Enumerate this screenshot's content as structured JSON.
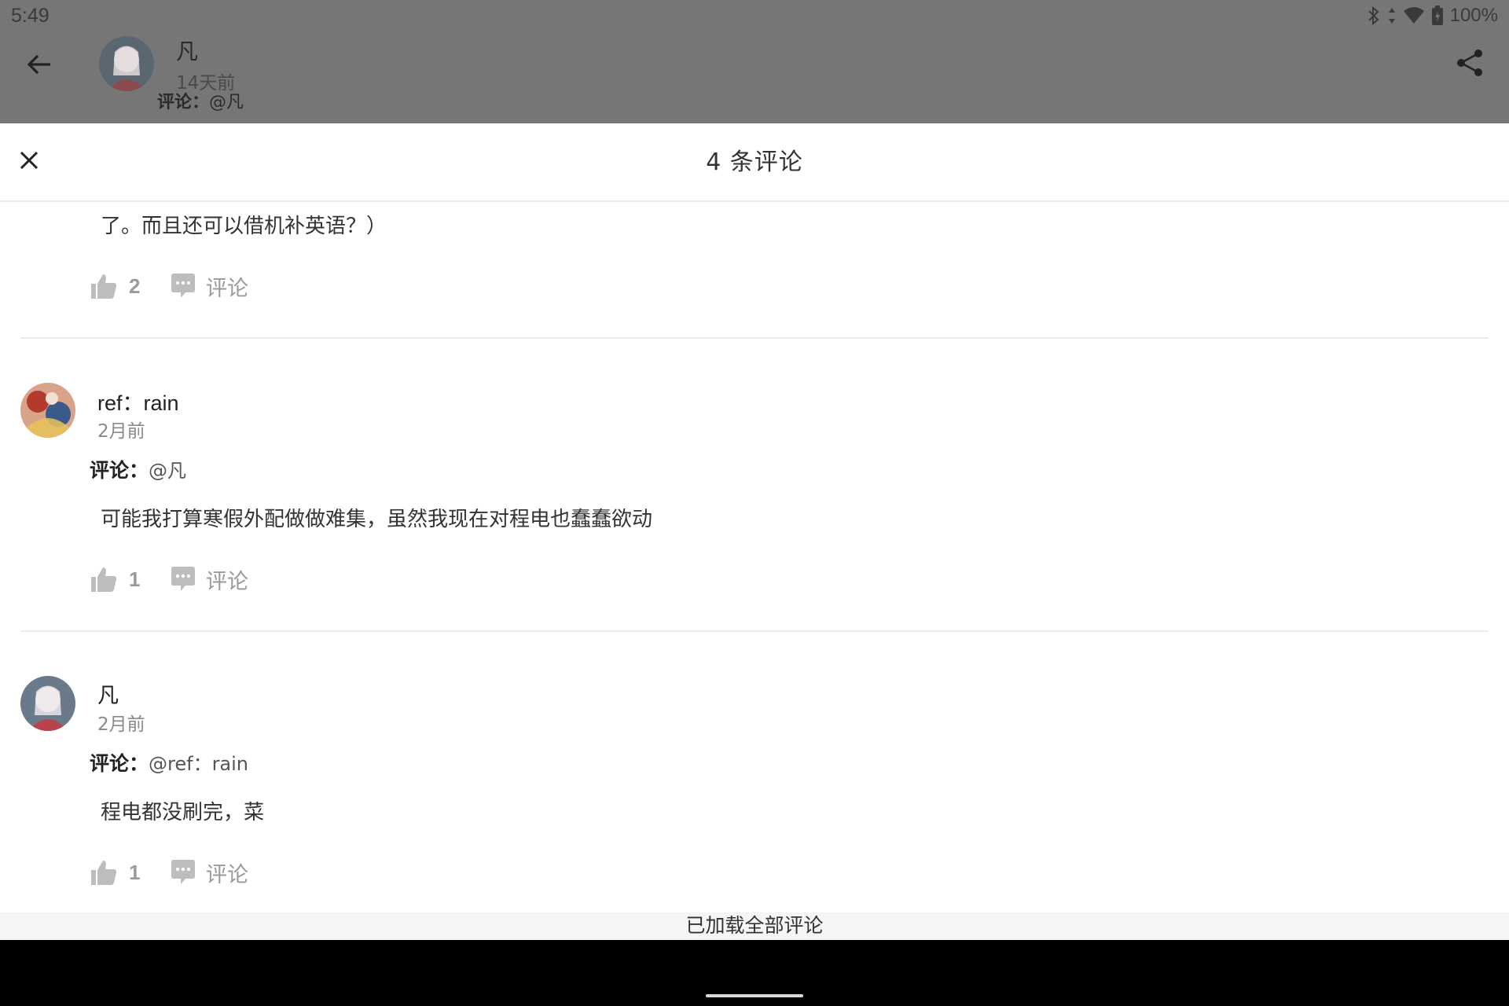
{
  "status_bar": {
    "time": "5:49",
    "battery": "100%"
  },
  "post_header": {
    "author": "凡",
    "time": "14天前",
    "sub_label": "评论：",
    "sub_mention": "@凡"
  },
  "sheet": {
    "title": "4 条评论"
  },
  "comments": [
    {
      "text": "了。而且还可以借机补英语？）",
      "likes": "2",
      "reply_label": "评论"
    },
    {
      "author": "ref：rain",
      "time": "2月前",
      "reply_to_label": "评论：",
      "reply_to_mention": "@凡",
      "text": "可能我打算寒假外配做做难集，虽然我现在对程电也蠢蠢欲动",
      "likes": "1",
      "reply_label": "评论"
    },
    {
      "author": "凡",
      "time": "2月前",
      "reply_to_label": "评论：",
      "reply_to_mention": "@ref：rain",
      "text": "程电都没刷完，菜",
      "likes": "1",
      "reply_label": "评论"
    }
  ],
  "footer": {
    "loaded_text": "已加载全部评论"
  },
  "colors": {
    "scrim": "#767676",
    "muted": "#9a9a9a",
    "text": "#333333"
  }
}
